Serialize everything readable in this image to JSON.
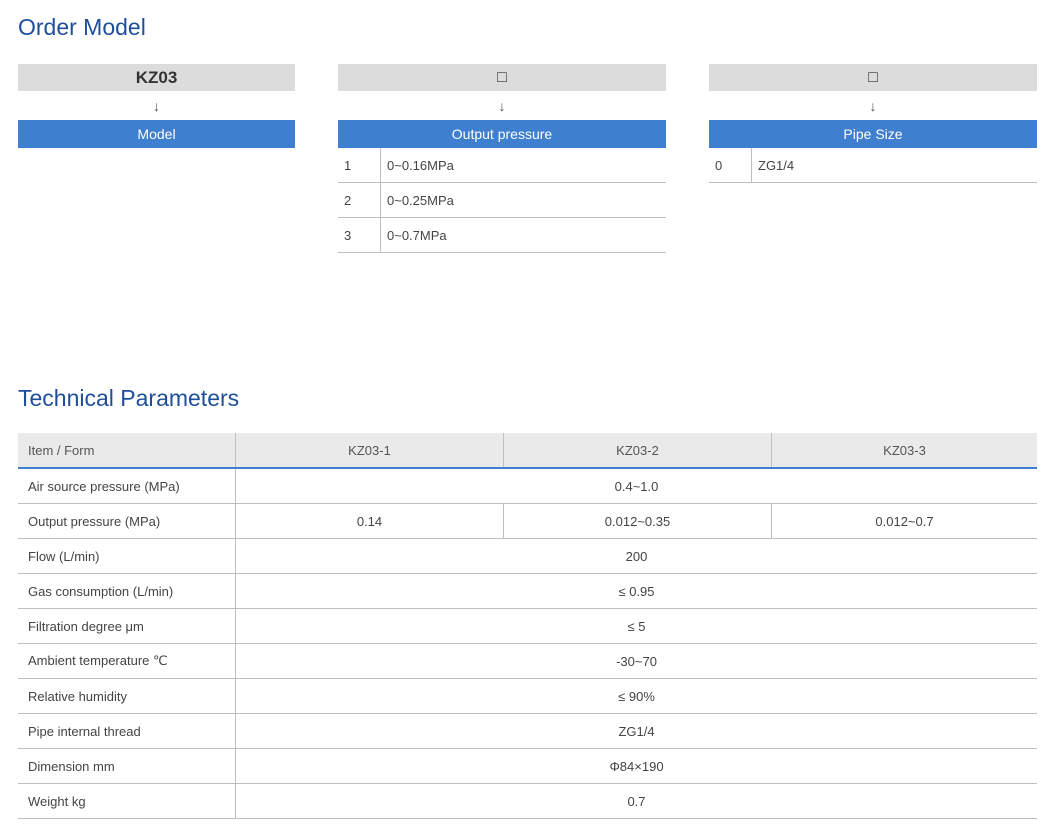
{
  "order_model": {
    "title": "Order Model",
    "arrow": "↓",
    "columns": [
      {
        "code": "KZ03",
        "header": "Model",
        "options": []
      },
      {
        "code": "□",
        "header": "Output pressure",
        "options": [
          {
            "num": "1",
            "value": "0~0.16MPa"
          },
          {
            "num": "2",
            "value": "0~0.25MPa"
          },
          {
            "num": "3",
            "value": "0~0.7MPa"
          }
        ]
      },
      {
        "code": "□",
        "header": "Pipe Size",
        "options": [
          {
            "num": "0",
            "value": "ZG1/4"
          }
        ]
      }
    ]
  },
  "technical": {
    "title": "Technical Parameters",
    "headers": [
      "Item / Form",
      "KZ03-1",
      "KZ03-2",
      "KZ03-3"
    ],
    "rows": [
      {
        "item": "Air source pressure  (MPa)",
        "values": [
          "0.4~1.0"
        ]
      },
      {
        "item": "Output pressure (MPa)",
        "values": [
          "0.14",
          "0.012~0.35",
          "0.012~0.7"
        ]
      },
      {
        "item": "Flow (L/min)",
        "values": [
          "200"
        ]
      },
      {
        "item": "Gas consumption (L/min)",
        "values": [
          "≤ 0.95"
        ]
      },
      {
        "item": "Filtration degree μm",
        "values": [
          "≤ 5"
        ]
      },
      {
        "item": "Ambient temperature ℃",
        "values": [
          "-30~70"
        ]
      },
      {
        "item": "Relative humidity",
        "values": [
          "≤ 90%"
        ]
      },
      {
        "item": "Pipe internal thread",
        "values": [
          "ZG1/4"
        ]
      },
      {
        "item": "Dimension mm",
        "values": [
          "Φ84×190"
        ]
      },
      {
        "item": "Weight kg",
        "values": [
          "0.7"
        ]
      }
    ]
  },
  "colors": {
    "accent": "#3f7fd0",
    "title": "#1f4f9a",
    "code_bg": "#dcdcdc"
  }
}
